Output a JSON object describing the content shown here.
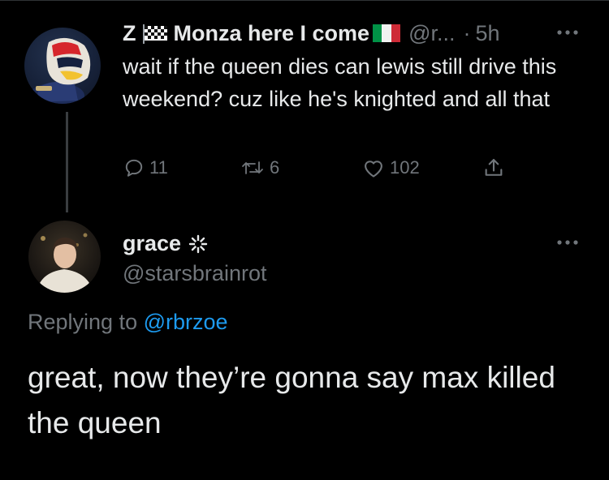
{
  "parent_tweet": {
    "display_name_prefix": "Z",
    "display_name_main": "Monza here I come",
    "handle": "@r...",
    "time": "5h",
    "dot": "·",
    "text": "wait if the queen dies can lewis still drive this weekend? cuz like he's knighted and all that",
    "stats": {
      "replies": "11",
      "retweets": "6",
      "likes": "102"
    },
    "icons": {
      "avatar": "racing-helmet-avatar",
      "checkered_flag": "checkered-flag-icon",
      "italy_flag": "italy-flag-icon",
      "more": "more-icon"
    },
    "colors": {
      "flag_green": "#009246",
      "flag_white": "#f1f2f1",
      "flag_red": "#ce2b37"
    }
  },
  "reply_tweet": {
    "display_name": "grace",
    "sparkle": "✲",
    "handle": "@starsbrainrot",
    "replying_to_label": "Replying to",
    "replying_to_handle": "@rbrzoe",
    "text": "great, now they’re gonna say max killed the queen",
    "icons": {
      "avatar": "user-photo-avatar",
      "more": "more-icon"
    }
  },
  "colors": {
    "background": "#000000",
    "primary_text": "#e7e9ea",
    "secondary_text": "#71767b",
    "accent_link": "#1d9bf0"
  }
}
